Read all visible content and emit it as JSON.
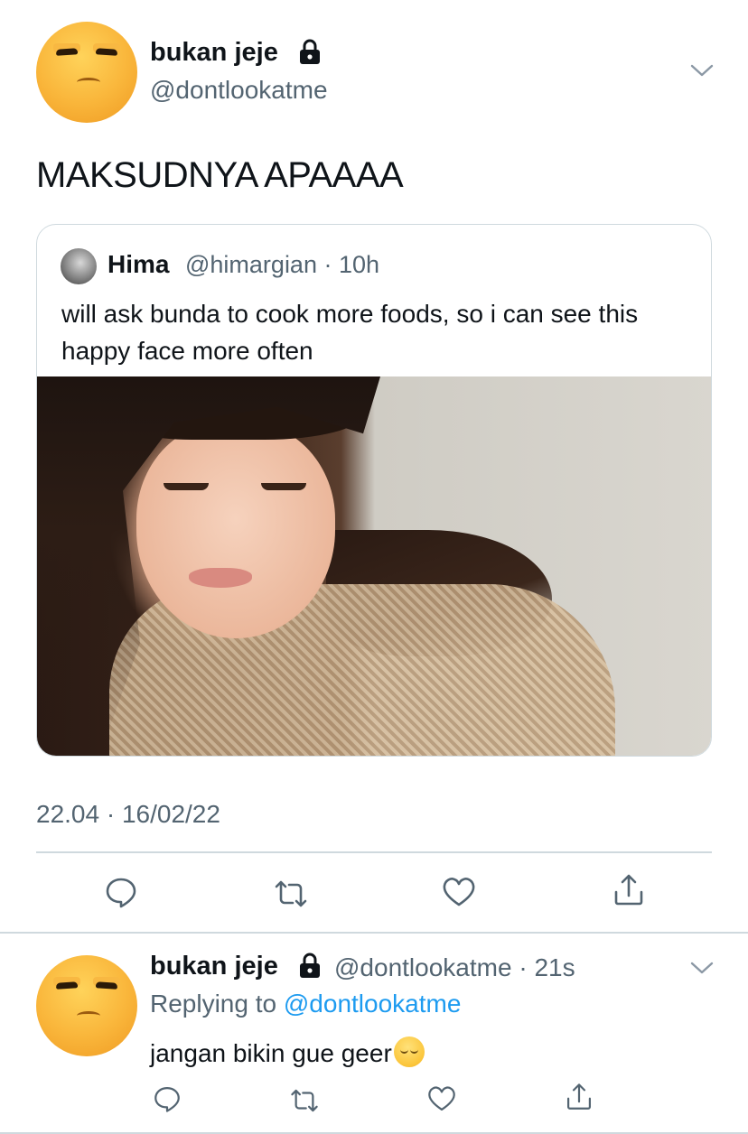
{
  "main_tweet": {
    "author_name": "bukan jeje",
    "author_handle": "@dontlookatme",
    "text": "MAKSUDNYA APAAAA",
    "timestamp": "22.04 · 16/02/22",
    "icons": {
      "lock": "lock-icon",
      "more": "chevron-down-icon"
    }
  },
  "quoted_tweet": {
    "author_name": "Hima",
    "author_handle": "@himargian",
    "time_ago": "10h",
    "text": "will ask bunda to cook more foods, so i can see this happy face more often"
  },
  "actions": [
    {
      "name": "reply",
      "icon": "reply-icon"
    },
    {
      "name": "retweet",
      "icon": "retweet-icon"
    },
    {
      "name": "like",
      "icon": "heart-icon"
    },
    {
      "name": "share",
      "icon": "share-icon"
    }
  ],
  "reply_tweet": {
    "author_name": "bukan jeje",
    "author_handle": "@dontlookatme",
    "time_ago": "21s",
    "replying_label": "Replying to",
    "replying_handle": "@dontlookatme",
    "text": "jangan bikin gue geer",
    "emoji": "pensive-face"
  },
  "colors": {
    "text": "#0f1419",
    "secondary": "#536471",
    "link": "#1d9bf0",
    "border": "#cfd9de"
  }
}
